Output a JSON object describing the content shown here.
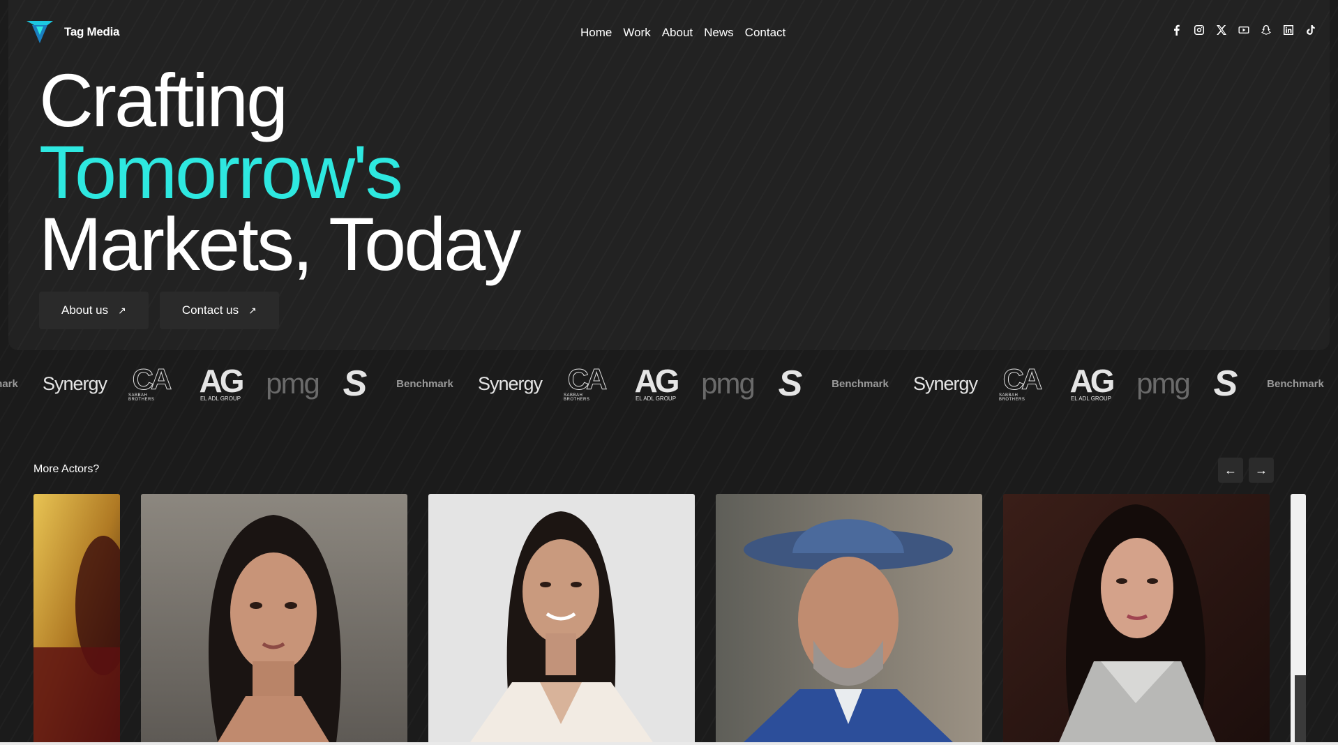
{
  "brand": {
    "name": "Tag Media",
    "accent": "#2ee8e0"
  },
  "nav": [
    "Home",
    "Work",
    "About",
    "News",
    "Contact"
  ],
  "social_icons": [
    "facebook-icon",
    "instagram-icon",
    "x-icon",
    "youtube-icon",
    "snapchat-icon",
    "linkedin-icon",
    "tiktok-icon"
  ],
  "hero": {
    "line1": "Crafting",
    "line2": "Tomorrow's",
    "line3": "Markets, Today",
    "buttons": [
      "About us",
      "Contact us"
    ]
  },
  "clients": {
    "benchmark": "Benchmark",
    "synergy": "Synergy",
    "ca": "CA",
    "ca_sub": "SABBAH BROTHERS",
    "ag": "AG",
    "ag_sub": "EL ADL GROUP",
    "pmg": "pmg",
    "s": "S"
  },
  "actors": {
    "title": "More Actors?",
    "prev": "←",
    "next": "→"
  }
}
